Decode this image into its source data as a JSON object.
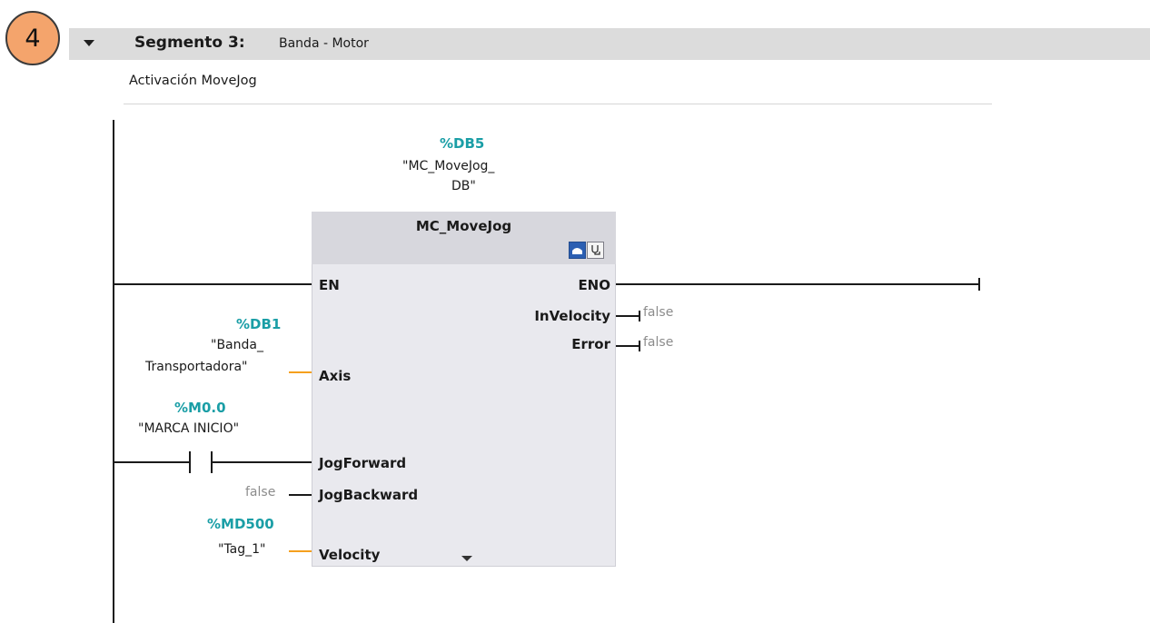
{
  "badge": "4",
  "segment": {
    "title": "Segmento 3:",
    "name": "Banda - Motor",
    "comment": "Activación MoveJog"
  },
  "instance": {
    "address": "%DB5",
    "name_line1": "\"MC_MoveJog_",
    "name_line2": "DB\""
  },
  "block": {
    "title": "MC_MoveJog",
    "inputs": {
      "en": "EN",
      "axis": "Axis",
      "jog_forward": "JogForward",
      "jog_backward": "JogBackward",
      "velocity": "Velocity"
    },
    "outputs": {
      "eno": "ENO",
      "in_velocity": "InVelocity",
      "error": "Error"
    }
  },
  "operands": {
    "axis": {
      "address": "%DB1",
      "name_line1": "\"Banda_",
      "name_line2": "Transportadora\""
    },
    "contact": {
      "address": "%M0.0",
      "name": "\"MARCA INICIO\""
    },
    "jog_backward_value": "false",
    "velocity": {
      "address": "%MD500",
      "name": "\"Tag_1\""
    },
    "in_velocity_value": "false",
    "error_value": "false"
  },
  "colors": {
    "address_teal": "#1a9ea6",
    "wire_orange": "#f5a01e",
    "badge_orange": "#f4a46c",
    "header_gray": "#dcdcdc",
    "block_fill": "#e9e9ee"
  },
  "icons": [
    "chevron-down-icon",
    "block-instance-icon",
    "diagnostics-icon",
    "expand-caret-icon"
  ]
}
